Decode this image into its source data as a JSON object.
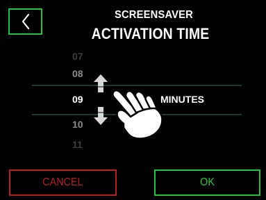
{
  "header": {
    "title_line1": "SCREENSAVER",
    "title_line2": "ACTIVATION TIME"
  },
  "picker": {
    "values": [
      "07",
      "08",
      "09",
      "10",
      "11"
    ],
    "selected": "09",
    "unit_label": "MINUTES"
  },
  "buttons": {
    "cancel_label": "CANCEL",
    "ok_label": "OK"
  },
  "icons": {
    "back": "chevron-left-icon",
    "scroll_up": "arrow-up-icon",
    "scroll_down": "arrow-down-icon",
    "gesture": "hand-pointer-icon"
  },
  "colors": {
    "background": "#000000",
    "accent_green": "#22c33a",
    "cancel_red": "#b32020",
    "picker_line": "#1c3a2a"
  }
}
